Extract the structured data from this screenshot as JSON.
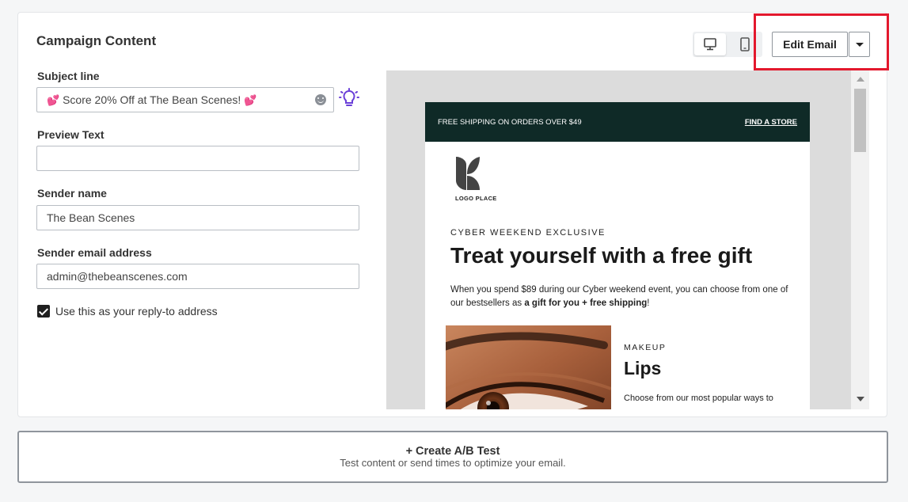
{
  "card": {
    "title": "Campaign Content"
  },
  "form": {
    "subject": {
      "label": "Subject line",
      "heart": "💕",
      "value": "Score 20% Off at The Bean Scenes!"
    },
    "preview": {
      "label": "Preview Text",
      "value": ""
    },
    "sender_name": {
      "label": "Sender name",
      "value": "The Bean Scenes"
    },
    "sender_email": {
      "label": "Sender email address",
      "value": "admin@thebeanscenes.com"
    },
    "reply_to": {
      "label": "Use this as your reply-to address",
      "checked": true
    }
  },
  "toolbar": {
    "edit_label": "Edit Email",
    "active_view": "desktop"
  },
  "email": {
    "shipping_text": "FREE SHIPPING ON ORDERS OVER $49",
    "find_store": "FIND A STORE",
    "logo_text": "LOGO PLACE",
    "eyebrow": "CYBER WEEKEND EXCLUSIVE",
    "headline": "Treat yourself with a free gift",
    "body_pre": "When you spend $89 during our Cyber weekend event, you can choose from one of our bestsellers as ",
    "body_bold1": "a gift for you",
    "body_plus": " + ",
    "body_bold2": "free shipping",
    "body_end": "!",
    "product_eyebrow": "MAKEUP",
    "product_title": "Lips",
    "product_copy": "Choose from our most popular ways to"
  },
  "ab_test": {
    "title": "+ Create A/B Test",
    "subtitle": "Test content or send times to optimize your email."
  },
  "colors": {
    "highlight": "#e3182d",
    "email_bar": "#0f2a27",
    "bulb": "#6a3fd8"
  }
}
